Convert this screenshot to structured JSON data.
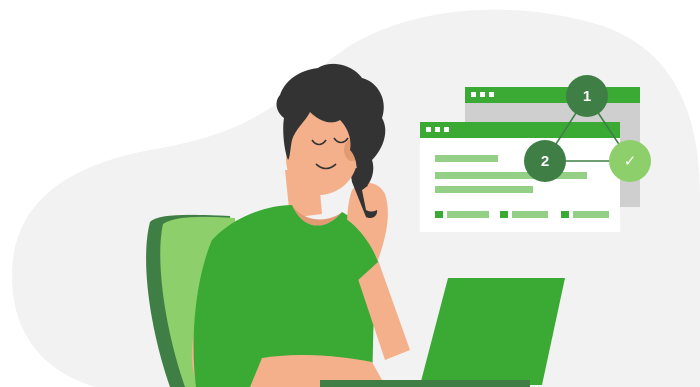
{
  "illustration": {
    "steps": [
      {
        "label": "1"
      },
      {
        "label": "2"
      },
      {
        "label": "✓"
      }
    ],
    "icons": [
      "browser-window-icon",
      "checkmark-icon",
      "smartphone-icon",
      "laptop-icon"
    ],
    "colors": {
      "background_blob": "#f2f2f2",
      "brand_green": "#3aaa35",
      "dark_green": "#3f7f46",
      "light_green": "#8dcf6a",
      "pale_green": "#93cf85",
      "skin": "#f4b08a",
      "hair": "#333333",
      "window_gray": "#cfcfcf"
    }
  }
}
